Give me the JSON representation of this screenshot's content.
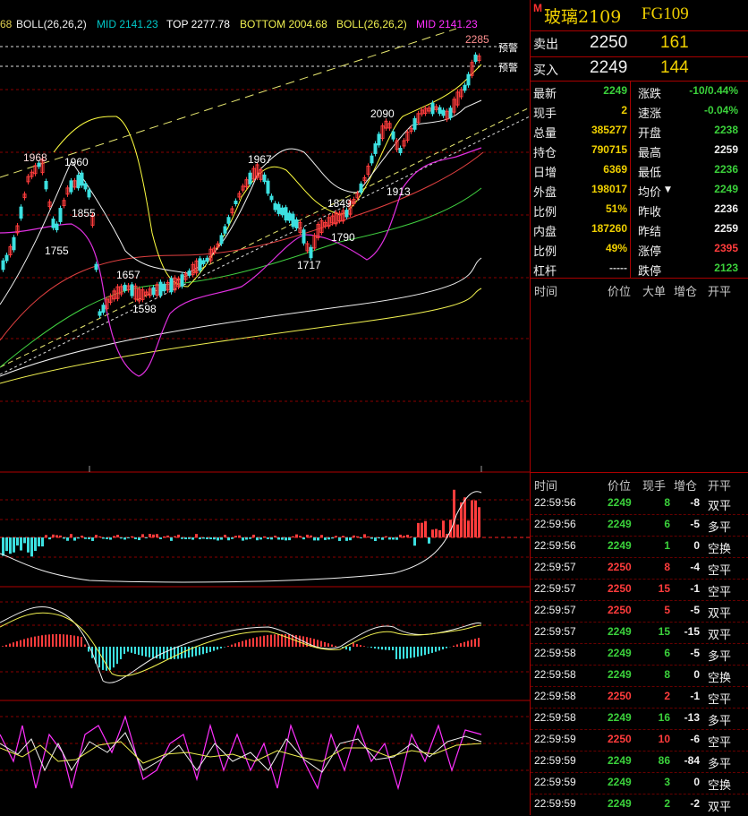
{
  "indicator_bar": {
    "prefix": "68",
    "boll_a": "BOLL(26,26,2)",
    "mid_a": "MID 2141.23",
    "top": "TOP 2277.78",
    "bottom": "BOTTOM 2004.68",
    "boll_b": "BOLL(26,26,2)",
    "mid_b": "MID 2141.23"
  },
  "price_labels": {
    "p2285": "2285",
    "p2090": "2090",
    "p1968": "1968",
    "p1960": "1960",
    "p1967": "1967",
    "p1855": "1855",
    "p1755": "1755",
    "p1849": "1849",
    "p1913": "1913",
    "p1790": "1790",
    "p1717": "1717",
    "p1657": "1657",
    "p1598": "1598"
  },
  "alerts": [
    "预警",
    "预警"
  ],
  "header": {
    "badge": "M",
    "title": "玻璃2109",
    "code": "FG109"
  },
  "order_book": {
    "sell_label": "卖出",
    "sell_price": "2250",
    "sell_qty": "161",
    "buy_label": "买入",
    "buy_price": "2249",
    "buy_qty": "144"
  },
  "quote": [
    {
      "l1": "最新",
      "v1": "2249",
      "c1": "green",
      "l2": "涨跌",
      "v2": "-10/0.44%",
      "c2": "green"
    },
    {
      "l1": "现手",
      "v1": "2",
      "c1": "yellow",
      "l2": "速涨",
      "v2": "-0.04%",
      "c2": "green"
    },
    {
      "l1": "总量",
      "v1": "385277",
      "c1": "yellow",
      "l2": "开盘",
      "v2": "2238",
      "c2": "green"
    },
    {
      "l1": "持仓",
      "v1": "790715",
      "c1": "yellow",
      "l2": "最高",
      "v2": "2259",
      "c2": "white"
    },
    {
      "l1": "日增",
      "v1": "6369",
      "c1": "yellow",
      "l2": "最低",
      "v2": "2236",
      "c2": "green"
    },
    {
      "l1": "外盘",
      "v1": "198017",
      "c1": "yellow",
      "l2": "均价",
      "v2": "2249",
      "c2": "green"
    },
    {
      "l1": "比例",
      "v1": "51%",
      "c1": "yellow",
      "l2": "昨收",
      "v2": "2236",
      "c2": "white"
    },
    {
      "l1": "内盘",
      "v1": "187260",
      "c1": "yellow",
      "l2": "昨结",
      "v2": "2259",
      "c2": "white"
    },
    {
      "l1": "比例",
      "v1": "49%",
      "c1": "yellow",
      "l2": "涨停",
      "v2": "2395",
      "c2": "red"
    },
    {
      "l1": "杠杆",
      "v1": "-----",
      "c1": "gray",
      "l2": "跌停",
      "v2": "2123",
      "c2": "green"
    }
  ],
  "big_orders_header": [
    "时间",
    "价位",
    "大单",
    "增仓",
    "开平"
  ],
  "ticks_header": [
    "时间",
    "价位",
    "现手",
    "增仓",
    "开平"
  ],
  "ticks": [
    {
      "time": "22:59:56",
      "price": "2249",
      "pc": "green",
      "qty": "8",
      "qc": "green",
      "oi": "-8",
      "type": "双平"
    },
    {
      "time": "22:59:56",
      "price": "2249",
      "pc": "green",
      "qty": "6",
      "qc": "green",
      "oi": "-5",
      "type": "多平"
    },
    {
      "time": "22:59:56",
      "price": "2249",
      "pc": "green",
      "qty": "1",
      "qc": "green",
      "oi": "0",
      "type": "空换"
    },
    {
      "time": "22:59:57",
      "price": "2250",
      "pc": "red",
      "qty": "8",
      "qc": "red",
      "oi": "-4",
      "type": "空平"
    },
    {
      "time": "22:59:57",
      "price": "2250",
      "pc": "red",
      "qty": "15",
      "qc": "red",
      "oi": "-1",
      "type": "空平"
    },
    {
      "time": "22:59:57",
      "price": "2250",
      "pc": "red",
      "qty": "5",
      "qc": "red",
      "oi": "-5",
      "type": "双平"
    },
    {
      "time": "22:59:57",
      "price": "2249",
      "pc": "green",
      "qty": "15",
      "qc": "green",
      "oi": "-15",
      "type": "双平"
    },
    {
      "time": "22:59:58",
      "price": "2249",
      "pc": "green",
      "qty": "6",
      "qc": "green",
      "oi": "-5",
      "type": "多平"
    },
    {
      "time": "22:59:58",
      "price": "2249",
      "pc": "green",
      "qty": "8",
      "qc": "green",
      "oi": "0",
      "type": "空换"
    },
    {
      "time": "22:59:58",
      "price": "2250",
      "pc": "red",
      "qty": "2",
      "qc": "red",
      "oi": "-1",
      "type": "空平"
    },
    {
      "time": "22:59:58",
      "price": "2249",
      "pc": "green",
      "qty": "16",
      "qc": "green",
      "oi": "-13",
      "type": "多平"
    },
    {
      "time": "22:59:59",
      "price": "2250",
      "pc": "red",
      "qty": "10",
      "qc": "red",
      "oi": "-6",
      "type": "空平"
    },
    {
      "time": "22:59:59",
      "price": "2249",
      "pc": "green",
      "qty": "86",
      "qc": "green",
      "oi": "-84",
      "type": "多平"
    },
    {
      "time": "22:59:59",
      "price": "2249",
      "pc": "green",
      "qty": "3",
      "qc": "green",
      "oi": "0",
      "type": "空换"
    },
    {
      "time": "22:59:59",
      "price": "2249",
      "pc": "green",
      "qty": "2",
      "qc": "green",
      "oi": "-2",
      "type": "双平"
    }
  ],
  "colors": {
    "up": "#ff3c3c",
    "down": "#3ce0e0",
    "grid": "#a00000",
    "mid": "#00c8c8",
    "top": "#ffff40",
    "bottom": "#ff30ff"
  }
}
